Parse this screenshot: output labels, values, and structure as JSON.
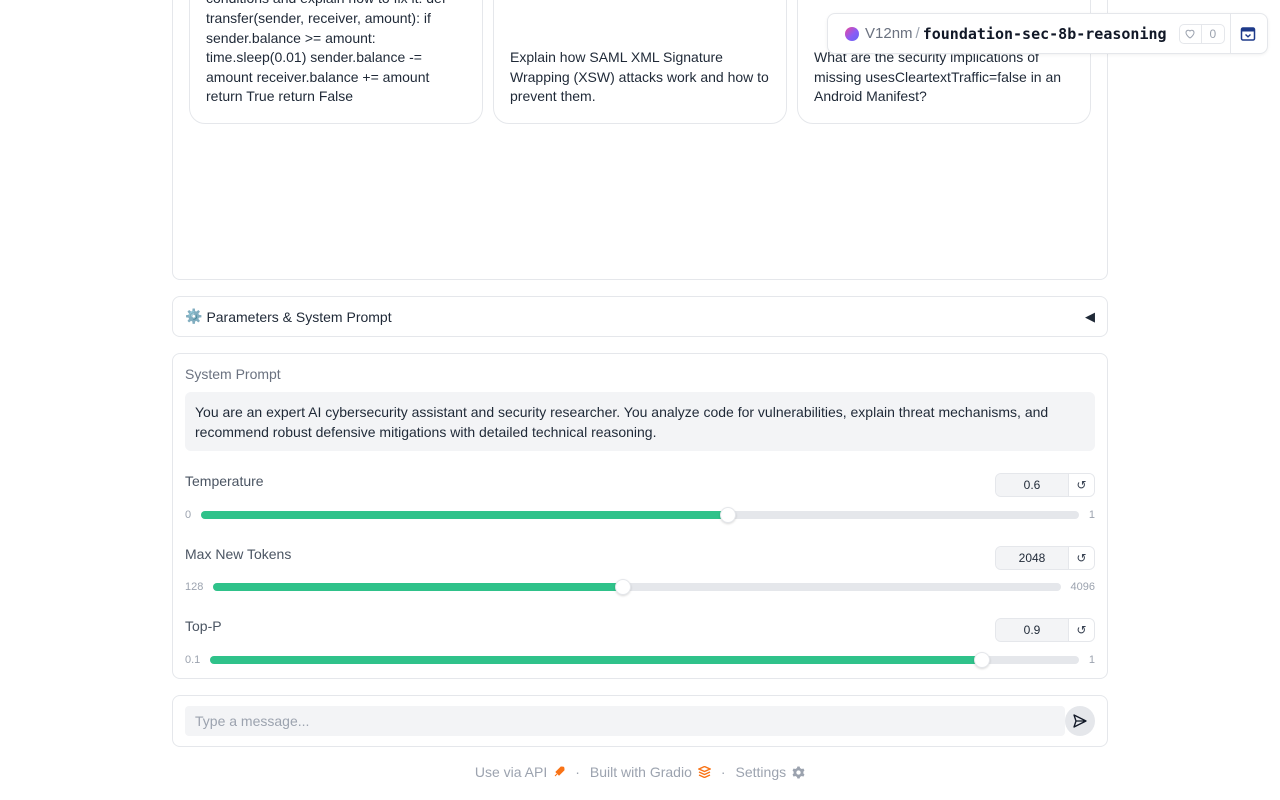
{
  "examples": [
    {
      "lines": [
        "conditions and explain how to fix it: def",
        "transfer(sender, receiver, amount): if",
        "sender.balance >= amount:",
        "time.sleep(0.01) sender.balance -=",
        "amount receiver.balance += amount",
        "return True return False"
      ]
    },
    {
      "lines": [
        "Explain how SAML XML Signature",
        "Wrapping (XSW) attacks work and how to",
        "prevent them."
      ]
    },
    {
      "lines": [
        "What are the security implications of",
        "missing usesCleartextTraffic=false in an",
        "Android Manifest?"
      ]
    }
  ],
  "space": {
    "owner": "V12nm",
    "separator": "/",
    "name": "foundation-sec-8b-reasoning",
    "likes": "0"
  },
  "accordion": {
    "icon": "⚙️",
    "label": "Parameters & System Prompt",
    "arrow": "◀"
  },
  "system_prompt": {
    "label": "System Prompt",
    "value": "You are an expert AI cybersecurity assistant and security researcher. You analyze code for vulnerabilities, explain threat mechanisms, and recommend robust defensive mitigations with detailed technical reasoning."
  },
  "sliders": {
    "temperature": {
      "label": "Temperature",
      "value": "0.6",
      "min": "0",
      "max": "1",
      "fraction": 0.6
    },
    "max_tokens": {
      "label": "Max New Tokens",
      "value": "2048",
      "min": "128",
      "max": "4096",
      "fraction": 0.484
    },
    "top_p": {
      "label": "Top-P",
      "value": "0.9",
      "min": "0.1",
      "max": "1",
      "fraction": 0.889
    }
  },
  "reset_glyph": "↺",
  "message_input": {
    "placeholder": "Type a message..."
  },
  "footer": {
    "api": "Use via API",
    "built": "Built with Gradio",
    "settings": "Settings",
    "separator": "·"
  },
  "colors": {
    "accent": "#2fc28a",
    "border": "#e5e7eb",
    "input_bg": "#f3f4f6"
  }
}
